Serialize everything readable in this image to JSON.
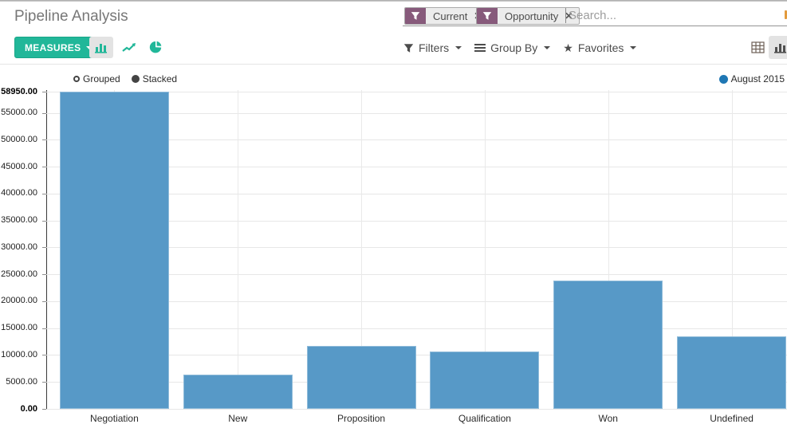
{
  "header": {
    "title": "Pipeline Analysis",
    "measures_label": "MEASURES",
    "search": {
      "facets": [
        {
          "label": "Current"
        },
        {
          "label": "Opportunity"
        }
      ],
      "placeholder": "Search...",
      "remove_glyph": "✕"
    },
    "filters_label": "Filters",
    "group_by_label": "Group By",
    "favorites_label": "Favorites",
    "favorites_star_glyph": "★"
  },
  "chart_controls": {
    "grouped_label": "Grouped",
    "stacked_label": "Stacked",
    "active": "Stacked"
  },
  "legend": {
    "label": "August 2015",
    "color": "#1f77b4",
    "position": "top-right"
  },
  "chart_data": {
    "type": "bar",
    "title": "Pipeline Analysis",
    "categories": [
      "Negotiation",
      "New",
      "Proposition",
      "Qualification",
      "Won",
      "Undefined"
    ],
    "series": [
      {
        "name": "August 2015",
        "color": "#5799c7",
        "values": [
          58950,
          6370,
          11700,
          10660,
          23850,
          13480
        ]
      }
    ],
    "xlabel": "",
    "ylabel": "",
    "ylim": [
      0,
      58950
    ],
    "yticks": [
      0,
      5000,
      10000,
      15000,
      20000,
      25000,
      30000,
      35000,
      40000,
      45000,
      50000,
      55000,
      58950
    ],
    "ytick_decimals": 2,
    "grid": true,
    "legend_position": "top-right"
  },
  "colors": {
    "accent_green": "#21b799",
    "facet_purple": "#875a7b",
    "bar_blue": "#5799c7",
    "legend_blue": "#1f77b4"
  },
  "icons": {
    "facet_icon": "funnel-icon",
    "filters_icon": "funnel-icon",
    "group_by_icon": "list-lines-icon",
    "favorites_icon": "star-icon",
    "chart_types": [
      "bar-chart-icon",
      "line-chart-icon",
      "pie-chart-icon"
    ],
    "view_switcher": [
      "pivot-grid-icon",
      "bar-chart-icon"
    ]
  }
}
